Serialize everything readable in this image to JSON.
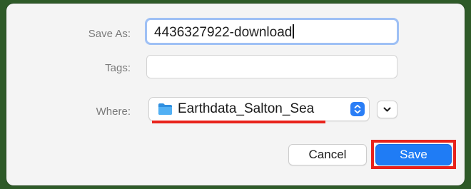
{
  "dialog": {
    "save_as": {
      "label": "Save As:",
      "value": "4436327922-download"
    },
    "tags": {
      "label": "Tags:",
      "value": ""
    },
    "where": {
      "label": "Where:",
      "selected": "Earthdata_Salton_Sea",
      "icon": "folder-icon"
    },
    "buttons": {
      "cancel": "Cancel",
      "save": "Save"
    }
  },
  "colors": {
    "accent": "#1f7cf5",
    "highlight": "#e8231b",
    "focus_ring": "#9ec0f5",
    "folder": "#3fa2ee"
  }
}
